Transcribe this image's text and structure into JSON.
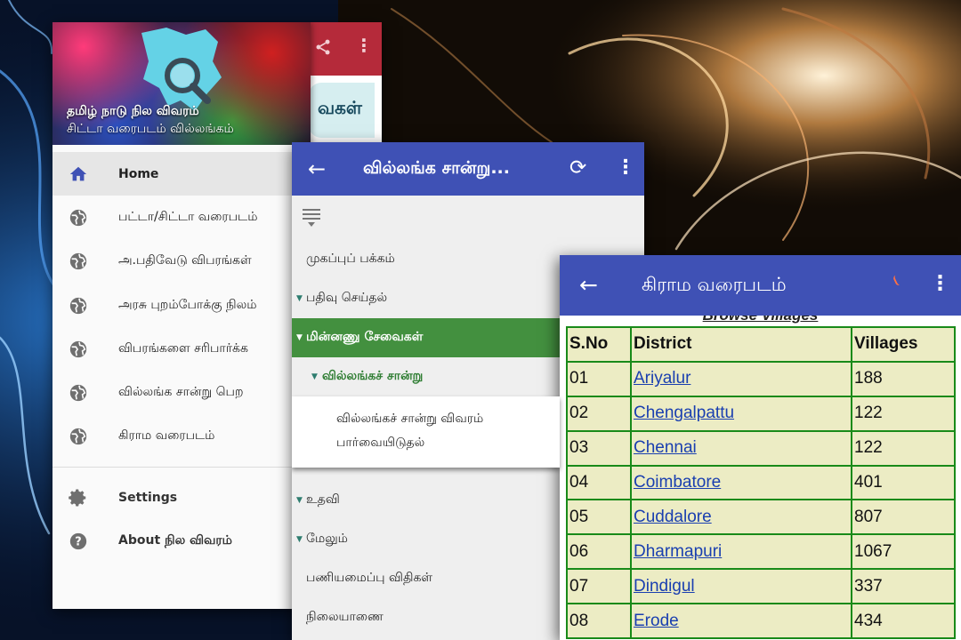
{
  "drawer": {
    "header_title": "தமிழ் நாடு நில விவரம்",
    "header_subtitle": "சிட்டா வரைபடம் வில்லங்கம்",
    "peek_text": "வகள்",
    "items": [
      {
        "label": "Home",
        "icon": "home-icon",
        "active": true
      },
      {
        "label": "பட்டா/சிட்டா வரைபடம்",
        "icon": "globe-icon"
      },
      {
        "label": "அ.பதிவேடு விபரங்கள்",
        "icon": "globe-icon"
      },
      {
        "label": "அரசு புறம்போக்கு நிலம்",
        "icon": "globe-icon"
      },
      {
        "label": "விபரங்களை சரிபார்க்க",
        "icon": "globe-icon"
      },
      {
        "label": "வில்லங்க சான்று பெற",
        "icon": "globe-icon"
      },
      {
        "label": "கிராம வரைபடம்",
        "icon": "globe-icon"
      }
    ],
    "footer_items": [
      {
        "label": "Settings",
        "icon": "gear-icon"
      },
      {
        "label": "About நில விவரம்",
        "icon": "help-icon"
      }
    ]
  },
  "screen2": {
    "title": "வில்லங்க சான்று...",
    "rows": [
      {
        "label": "முகப்புப் பக்கம்"
      },
      {
        "label": "பதிவு செய்தல்"
      },
      {
        "label": "மின்னணு சேவைகள்"
      },
      {
        "label": "வில்லங்கச் சான்று"
      },
      {
        "label": "வில்லங்கச் சான்று விவரம் பார்வையிடுதல்"
      },
      {
        "label": "உதவி"
      },
      {
        "label": "மேலும்"
      },
      {
        "label": "பணியமைப்பு விதிகள்"
      },
      {
        "label": "நிலையாணை"
      }
    ]
  },
  "screen3": {
    "title": "கிராம வரைபடம்",
    "caption": "Browse Villages",
    "headers": [
      "S.No",
      "District",
      "Villages"
    ],
    "rows": [
      [
        "01",
        "Ariyalur",
        "188"
      ],
      [
        "02",
        "Chengalpattu",
        "122"
      ],
      [
        "03",
        "Chennai",
        "122"
      ],
      [
        "04",
        "Coimbatore",
        "401"
      ],
      [
        "05",
        "Cuddalore",
        "807"
      ],
      [
        "06",
        "Dharmapuri",
        "1067"
      ],
      [
        "07",
        "Dindigul",
        "337"
      ],
      [
        "08",
        "Erode",
        "434"
      ]
    ]
  },
  "colors": {
    "indigo_appbar": "#3f51b5",
    "selected_green": "#43903f",
    "table_border": "#198a19",
    "table_bg": "#ececc4",
    "link_blue": "#1a3fb0"
  }
}
